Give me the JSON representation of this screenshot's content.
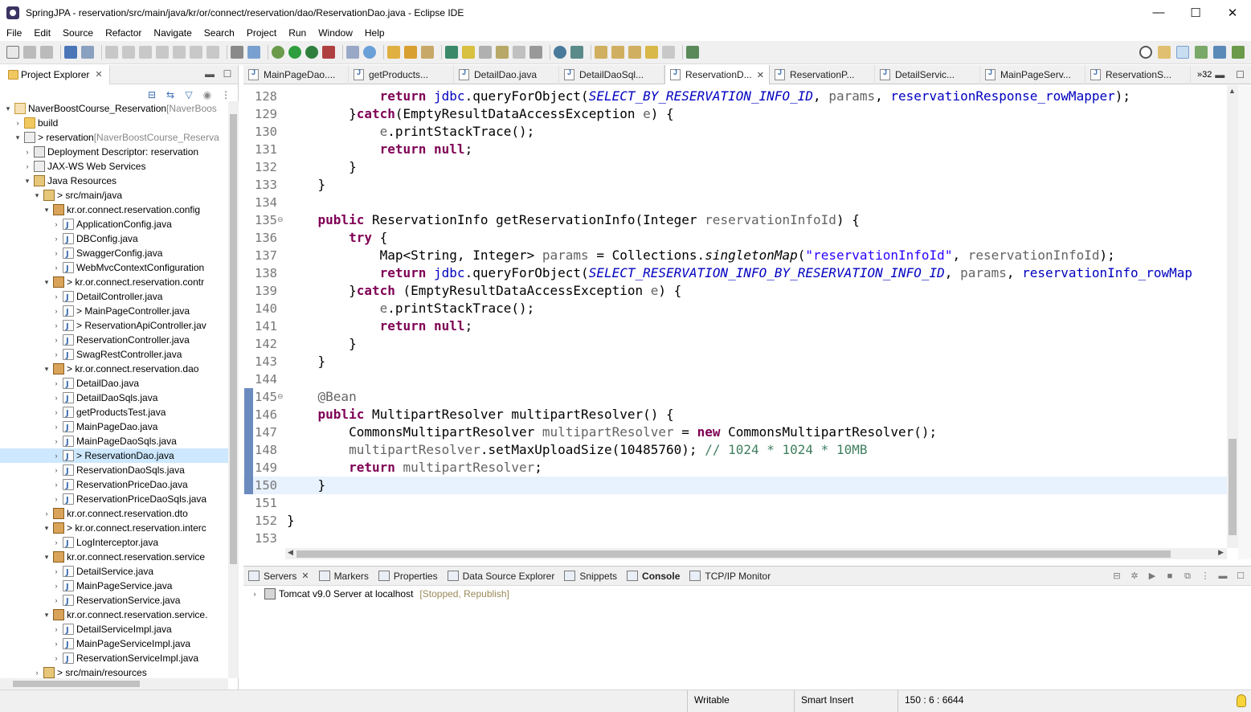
{
  "window": {
    "title": "SpringJPA - reservation/src/main/java/kr/or/connect/reservation/dao/ReservationDao.java - Eclipse IDE",
    "minimize": "—",
    "maximize": "☐",
    "close": "✕"
  },
  "menu": [
    "File",
    "Edit",
    "Source",
    "Refactor",
    "Navigate",
    "Search",
    "Project",
    "Run",
    "Window",
    "Help"
  ],
  "project_explorer": {
    "tab_label": "Project Explorer",
    "tree": [
      {
        "indent": 0,
        "arrow": "down",
        "icon": "proj",
        "label": "NaverBoostCourse_Reservation",
        "extra": " [NaverBoos"
      },
      {
        "indent": 1,
        "arrow": "right",
        "icon": "folder",
        "label": "build",
        "extra": ""
      },
      {
        "indent": 1,
        "arrow": "down",
        "icon": "web",
        "label": "> reservation",
        "extra": " [NaverBoostCourse_Reserva"
      },
      {
        "indent": 2,
        "arrow": "right",
        "icon": "dd",
        "label": "Deployment Descriptor: reservation",
        "extra": ""
      },
      {
        "indent": 2,
        "arrow": "right",
        "icon": "web",
        "label": "JAX-WS Web Services",
        "extra": ""
      },
      {
        "indent": 2,
        "arrow": "down",
        "icon": "src",
        "label": "Java Resources",
        "extra": ""
      },
      {
        "indent": 3,
        "arrow": "down",
        "icon": "src",
        "label": "> src/main/java",
        "extra": ""
      },
      {
        "indent": 4,
        "arrow": "down",
        "icon": "pkg",
        "label": "kr.or.connect.reservation.config",
        "extra": ""
      },
      {
        "indent": 5,
        "arrow": "right",
        "icon": "java",
        "label": "ApplicationConfig.java",
        "extra": ""
      },
      {
        "indent": 5,
        "arrow": "right",
        "icon": "java",
        "label": "DBConfig.java",
        "extra": ""
      },
      {
        "indent": 5,
        "arrow": "right",
        "icon": "java",
        "label": "SwaggerConfig.java",
        "extra": ""
      },
      {
        "indent": 5,
        "arrow": "right",
        "icon": "java",
        "label": "WebMvcContextConfiguration",
        "extra": ""
      },
      {
        "indent": 4,
        "arrow": "down",
        "icon": "pkg",
        "label": "> kr.or.connect.reservation.contr",
        "extra": ""
      },
      {
        "indent": 5,
        "arrow": "right",
        "icon": "java",
        "label": "DetailController.java",
        "extra": ""
      },
      {
        "indent": 5,
        "arrow": "right",
        "icon": "java",
        "label": "> MainPageController.java",
        "extra": ""
      },
      {
        "indent": 5,
        "arrow": "right",
        "icon": "java",
        "label": "> ReservationApiController.jav",
        "extra": ""
      },
      {
        "indent": 5,
        "arrow": "right",
        "icon": "java",
        "label": "ReservationController.java",
        "extra": ""
      },
      {
        "indent": 5,
        "arrow": "right",
        "icon": "java",
        "label": "SwagRestController.java",
        "extra": ""
      },
      {
        "indent": 4,
        "arrow": "down",
        "icon": "pkg",
        "label": "> kr.or.connect.reservation.dao",
        "extra": ""
      },
      {
        "indent": 5,
        "arrow": "right",
        "icon": "java",
        "label": "DetailDao.java",
        "extra": ""
      },
      {
        "indent": 5,
        "arrow": "right",
        "icon": "java",
        "label": "DetailDaoSqls.java",
        "extra": ""
      },
      {
        "indent": 5,
        "arrow": "right",
        "icon": "java",
        "label": "getProductsTest.java",
        "extra": ""
      },
      {
        "indent": 5,
        "arrow": "right",
        "icon": "java",
        "label": "MainPageDao.java",
        "extra": ""
      },
      {
        "indent": 5,
        "arrow": "right",
        "icon": "java",
        "label": "MainPageDaoSqls.java",
        "extra": ""
      },
      {
        "indent": 5,
        "arrow": "right",
        "icon": "java",
        "label": "> ReservationDao.java",
        "extra": "",
        "selected": true
      },
      {
        "indent": 5,
        "arrow": "right",
        "icon": "java",
        "label": "ReservationDaoSqls.java",
        "extra": ""
      },
      {
        "indent": 5,
        "arrow": "right",
        "icon": "java",
        "label": "ReservationPriceDao.java",
        "extra": ""
      },
      {
        "indent": 5,
        "arrow": "right",
        "icon": "java",
        "label": "ReservationPriceDaoSqls.java",
        "extra": ""
      },
      {
        "indent": 4,
        "arrow": "right",
        "icon": "pkg",
        "label": "kr.or.connect.reservation.dto",
        "extra": ""
      },
      {
        "indent": 4,
        "arrow": "down",
        "icon": "pkg",
        "label": "> kr.or.connect.reservation.interc",
        "extra": ""
      },
      {
        "indent": 5,
        "arrow": "right",
        "icon": "java",
        "label": "LogInterceptor.java",
        "extra": ""
      },
      {
        "indent": 4,
        "arrow": "down",
        "icon": "pkg",
        "label": "kr.or.connect.reservation.service",
        "extra": ""
      },
      {
        "indent": 5,
        "arrow": "right",
        "icon": "java",
        "label": "DetailService.java",
        "extra": ""
      },
      {
        "indent": 5,
        "arrow": "right",
        "icon": "java",
        "label": "MainPageService.java",
        "extra": ""
      },
      {
        "indent": 5,
        "arrow": "right",
        "icon": "java",
        "label": "ReservationService.java",
        "extra": ""
      },
      {
        "indent": 4,
        "arrow": "down",
        "icon": "pkg",
        "label": "kr.or.connect.reservation.service.",
        "extra": ""
      },
      {
        "indent": 5,
        "arrow": "right",
        "icon": "java",
        "label": "DetailServiceImpl.java",
        "extra": ""
      },
      {
        "indent": 5,
        "arrow": "right",
        "icon": "java",
        "label": "MainPageServiceImpl.java",
        "extra": ""
      },
      {
        "indent": 5,
        "arrow": "right",
        "icon": "java",
        "label": "ReservationServiceImpl.java",
        "extra": ""
      },
      {
        "indent": 3,
        "arrow": "right",
        "icon": "src",
        "label": "> src/main/resources",
        "extra": ""
      }
    ]
  },
  "editor_tabs": [
    {
      "label": "MainPageDao....",
      "active": false
    },
    {
      "label": "getProducts...",
      "active": false
    },
    {
      "label": "DetailDao.java",
      "active": false
    },
    {
      "label": "DetailDaoSql...",
      "active": false
    },
    {
      "label": "ReservationD...",
      "active": true
    },
    {
      "label": "ReservationP...",
      "active": false
    },
    {
      "label": "DetailServic...",
      "active": false
    },
    {
      "label": "MainPageServ...",
      "active": false
    },
    {
      "label": "ReservationS...",
      "active": false
    }
  ],
  "editor_tabs_more": "»32",
  "code": [
    {
      "n": "128",
      "fold": "",
      "chg": false,
      "cur": false,
      "t": [
        [
          "            ",
          ""
        ],
        [
          "return",
          "kw"
        ],
        [
          " ",
          ""
        ],
        [
          "jdbc",
          "fld"
        ],
        [
          ".queryForObject(",
          ""
        ],
        [
          "SELECT_BY_RESERVATION_INFO_ID",
          "cst"
        ],
        [
          ", ",
          ""
        ],
        [
          "params",
          "ann"
        ],
        [
          ", ",
          ""
        ],
        [
          "reservationResponse_rowMapper",
          "fld"
        ],
        [
          ");",
          ""
        ]
      ]
    },
    {
      "n": "129",
      "fold": "",
      "chg": false,
      "cur": false,
      "t": [
        [
          "        }",
          ""
        ],
        [
          "catch",
          "kw"
        ],
        [
          "(EmptyResultDataAccessException ",
          ""
        ],
        [
          "e",
          "ann"
        ],
        [
          ") {",
          ""
        ]
      ]
    },
    {
      "n": "130",
      "fold": "",
      "chg": false,
      "cur": false,
      "t": [
        [
          "            ",
          ""
        ],
        [
          "e",
          "ann"
        ],
        [
          ".printStackTrace();",
          ""
        ]
      ]
    },
    {
      "n": "131",
      "fold": "",
      "chg": false,
      "cur": false,
      "t": [
        [
          "            ",
          ""
        ],
        [
          "return",
          "kw"
        ],
        [
          " ",
          ""
        ],
        [
          "null",
          "kw"
        ],
        [
          ";",
          ""
        ]
      ]
    },
    {
      "n": "132",
      "fold": "",
      "chg": false,
      "cur": false,
      "t": [
        [
          "        }",
          ""
        ]
      ]
    },
    {
      "n": "133",
      "fold": "",
      "chg": false,
      "cur": false,
      "t": [
        [
          "    }",
          ""
        ]
      ]
    },
    {
      "n": "134",
      "fold": "",
      "chg": false,
      "cur": false,
      "t": [
        [
          "",
          ""
        ]
      ]
    },
    {
      "n": "135",
      "fold": "⊖",
      "chg": false,
      "cur": false,
      "t": [
        [
          "    ",
          ""
        ],
        [
          "public",
          "kw"
        ],
        [
          " ReservationInfo getReservationInfo(Integer ",
          ""
        ],
        [
          "reservationInfoId",
          "ann"
        ],
        [
          ") {",
          ""
        ]
      ]
    },
    {
      "n": "136",
      "fold": "",
      "chg": false,
      "cur": false,
      "t": [
        [
          "        ",
          ""
        ],
        [
          "try",
          "kw"
        ],
        [
          " {",
          ""
        ]
      ]
    },
    {
      "n": "137",
      "fold": "",
      "chg": false,
      "cur": false,
      "t": [
        [
          "            Map<String, Integer> ",
          ""
        ],
        [
          "params",
          "ann"
        ],
        [
          " = Collections.",
          ""
        ],
        [
          "singletonMap",
          "stat"
        ],
        [
          "(",
          ""
        ],
        [
          "\"reservationInfoId\"",
          "str"
        ],
        [
          ", ",
          ""
        ],
        [
          "reservationInfoId",
          "ann"
        ],
        [
          ");",
          ""
        ]
      ]
    },
    {
      "n": "138",
      "fold": "",
      "chg": false,
      "cur": false,
      "t": [
        [
          "            ",
          ""
        ],
        [
          "return",
          "kw"
        ],
        [
          " ",
          ""
        ],
        [
          "jdbc",
          "fld"
        ],
        [
          ".queryForObject(",
          ""
        ],
        [
          "SELECT_RESERVATION_INFO_BY_RESERVATION_INFO_ID",
          "cst"
        ],
        [
          ", ",
          ""
        ],
        [
          "params",
          "ann"
        ],
        [
          ", ",
          ""
        ],
        [
          "reservationInfo_rowMap",
          "fld"
        ]
      ]
    },
    {
      "n": "139",
      "fold": "",
      "chg": false,
      "cur": false,
      "t": [
        [
          "        }",
          ""
        ],
        [
          "catch",
          "kw"
        ],
        [
          " (EmptyResultDataAccessException ",
          ""
        ],
        [
          "e",
          "ann"
        ],
        [
          ") {",
          ""
        ]
      ]
    },
    {
      "n": "140",
      "fold": "",
      "chg": false,
      "cur": false,
      "t": [
        [
          "            ",
          ""
        ],
        [
          "e",
          "ann"
        ],
        [
          ".printStackTrace();",
          ""
        ]
      ]
    },
    {
      "n": "141",
      "fold": "",
      "chg": false,
      "cur": false,
      "t": [
        [
          "            ",
          ""
        ],
        [
          "return",
          "kw"
        ],
        [
          " ",
          ""
        ],
        [
          "null",
          "kw"
        ],
        [
          ";",
          ""
        ]
      ]
    },
    {
      "n": "142",
      "fold": "",
      "chg": false,
      "cur": false,
      "t": [
        [
          "        }",
          ""
        ]
      ]
    },
    {
      "n": "143",
      "fold": "",
      "chg": false,
      "cur": false,
      "t": [
        [
          "    }",
          ""
        ]
      ]
    },
    {
      "n": "144",
      "fold": "",
      "chg": false,
      "cur": false,
      "t": [
        [
          "",
          ""
        ]
      ]
    },
    {
      "n": "145",
      "fold": "⊖",
      "chg": true,
      "cur": false,
      "t": [
        [
          "    ",
          ""
        ],
        [
          "@Bean",
          "ann"
        ]
      ]
    },
    {
      "n": "146",
      "fold": "",
      "chg": true,
      "cur": false,
      "t": [
        [
          "    ",
          ""
        ],
        [
          "public",
          "kw"
        ],
        [
          " MultipartResolver multipartResolver() {",
          ""
        ]
      ]
    },
    {
      "n": "147",
      "fold": "",
      "chg": true,
      "cur": false,
      "t": [
        [
          "        CommonsMultipartResolver ",
          ""
        ],
        [
          "multipartResolver",
          "ann"
        ],
        [
          " = ",
          ""
        ],
        [
          "new",
          "kw"
        ],
        [
          " CommonsMultipartResolver();",
          ""
        ]
      ]
    },
    {
      "n": "148",
      "fold": "",
      "chg": true,
      "cur": false,
      "t": [
        [
          "        ",
          ""
        ],
        [
          "multipartResolver",
          "ann"
        ],
        [
          ".setMaxUploadSize(10485760); ",
          ""
        ],
        [
          "// 1024 * 1024 * 10MB",
          "cmt"
        ]
      ]
    },
    {
      "n": "149",
      "fold": "",
      "chg": true,
      "cur": false,
      "t": [
        [
          "        ",
          ""
        ],
        [
          "return",
          "kw"
        ],
        [
          " ",
          ""
        ],
        [
          "multipartResolver",
          "ann"
        ],
        [
          ";",
          ""
        ]
      ]
    },
    {
      "n": "150",
      "fold": "",
      "chg": true,
      "cur": true,
      "t": [
        [
          "    }",
          ""
        ]
      ]
    },
    {
      "n": "151",
      "fold": "",
      "chg": false,
      "cur": false,
      "t": [
        [
          "",
          ""
        ]
      ]
    },
    {
      "n": "152",
      "fold": "",
      "chg": false,
      "cur": false,
      "t": [
        [
          "}",
          ""
        ]
      ]
    },
    {
      "n": "153",
      "fold": "",
      "chg": false,
      "cur": false,
      "t": [
        [
          "",
          ""
        ]
      ]
    }
  ],
  "bottom_tabs": [
    {
      "label": "Servers",
      "active": false,
      "close": true
    },
    {
      "label": "Markers",
      "active": false,
      "close": false
    },
    {
      "label": "Properties",
      "active": false,
      "close": false
    },
    {
      "label": "Data Source Explorer",
      "active": false,
      "close": false
    },
    {
      "label": "Snippets",
      "active": false,
      "close": false
    },
    {
      "label": "Console",
      "active": true,
      "close": false
    },
    {
      "label": "TCP/IP Monitor",
      "active": false,
      "close": false
    }
  ],
  "server": {
    "name": "Tomcat v9.0 Server at localhost",
    "state": "[Stopped, Republish]"
  },
  "status": {
    "mode": "Writable",
    "insert": "Smart Insert",
    "position": "150 : 6 : 6644"
  },
  "colors": {
    "keyword": "#7f0055",
    "field": "#0000c0",
    "string": "#2a00ff",
    "comment": "#3f7f5f",
    "current_line": "#e8f2fe",
    "selection": "#cde8ff"
  }
}
